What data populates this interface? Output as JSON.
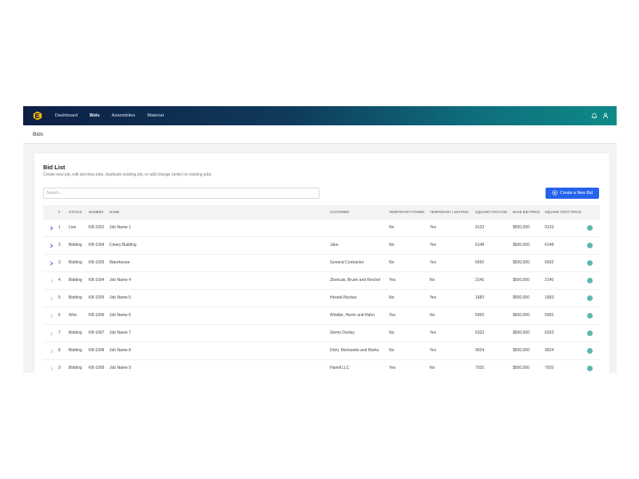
{
  "nav": {
    "items": [
      "Dashboard",
      "Bids",
      "Assemblies",
      "Material"
    ],
    "active_index": 1
  },
  "page": {
    "title": "Bids"
  },
  "bid_list": {
    "title": "Bid List",
    "subtitle": "Create new job, edit previous jobs, duplicate existing job, or add change (order) to existing jobs.",
    "search_placeholder": "Search...",
    "create_label": "Create a New Bid"
  },
  "table": {
    "headers": [
      "#",
      "STATUS",
      "NUMBER",
      "NAME",
      "CUSTOMER",
      "TEMPORARY POWER",
      "TEMPORARY LIGHTING",
      "SQUARE FOOTAGE",
      "BASE BID PRICE",
      "SQUARE FOOT PRICE"
    ],
    "rows": [
      {
        "num": "1",
        "status": "Live",
        "number": "KB-1001",
        "name": "Job Name 1",
        "customer": "",
        "temp_power": "No",
        "temp_lighting": "Yes",
        "square_footage": "9133",
        "base_bid_price": "$500,000",
        "square_foot_price": "9133",
        "expandable": true
      },
      {
        "num": "2",
        "status": "Bidding",
        "number": "KB-1004",
        "name": "Cleary Building",
        "customer": "Jake",
        "temp_power": "No",
        "temp_lighting": "Yes",
        "square_footage": "6148",
        "base_bid_price": "$500,000",
        "square_foot_price": "6148",
        "expandable": true
      },
      {
        "num": "3",
        "status": "Bidding",
        "number": "KB-1003",
        "name": "Warehouse",
        "customer": "General Contractor",
        "temp_power": "No",
        "temp_lighting": "Yes",
        "square_footage": "6592",
        "base_bid_price": "$500,000",
        "square_foot_price": "6592",
        "expandable": true
      },
      {
        "num": "4",
        "status": "Bidding",
        "number": "KB-1004",
        "name": "Job Name 4",
        "customer": "Zboncak, Bruen and Reichel",
        "temp_power": "Yes",
        "temp_lighting": "No",
        "square_footage": "2145",
        "base_bid_price": "$500,000",
        "square_foot_price": "2145",
        "expandable": false
      },
      {
        "num": "5",
        "status": "Bidding",
        "number": "KB-1005",
        "name": "Job Name 5",
        "customer": "Hessel-Nicolas",
        "temp_power": "No",
        "temp_lighting": "Yes",
        "square_footage": "1683",
        "base_bid_price": "$500,000",
        "square_foot_price": "1683",
        "expandable": false
      },
      {
        "num": "6",
        "status": "Won",
        "number": "KB-1006",
        "name": "Job Name 6",
        "customer": "Windler, Harris and Hahn",
        "temp_power": "Yes",
        "temp_lighting": "No",
        "square_footage": "5955",
        "base_bid_price": "$500,000",
        "square_foot_price": "5955",
        "expandable": false
      },
      {
        "num": "7",
        "status": "Bidding",
        "number": "KB-1007",
        "name": "Job Name 7",
        "customer": "Ziemo Dooley",
        "temp_power": "No",
        "temp_lighting": "Yes",
        "square_footage": "6333",
        "base_bid_price": "$500,000",
        "square_foot_price": "6333",
        "expandable": false
      },
      {
        "num": "8",
        "status": "Bidding",
        "number": "KB-1008",
        "name": "Job Name 8",
        "customer": "Dicki, Morissette and Marks",
        "temp_power": "No",
        "temp_lighting": "Yes",
        "square_footage": "9924",
        "base_bid_price": "$500,000",
        "square_foot_price": "9924",
        "expandable": false
      },
      {
        "num": "9",
        "status": "Bidding",
        "number": "KB-1009",
        "name": "Job Name 9",
        "customer": "Hamill LLC",
        "temp_power": "Yes",
        "temp_lighting": "No",
        "square_footage": "7925",
        "base_bid_price": "$500,000",
        "square_foot_price": "7925",
        "expandable": false
      }
    ]
  },
  "colors": {
    "topbar_start": "#0e1f45",
    "topbar_end": "#0e8a88",
    "accent": "#2563eb",
    "logo": "#f5b800",
    "status_dot": "#5cb8ad",
    "chevron_active": "#3b5bdb"
  },
  "icons": {
    "logo": "brand-logo-icon",
    "notifications": "bell-icon",
    "user": "user-icon",
    "create": "plus-circle-icon",
    "expand": "chevron-right-icon"
  }
}
